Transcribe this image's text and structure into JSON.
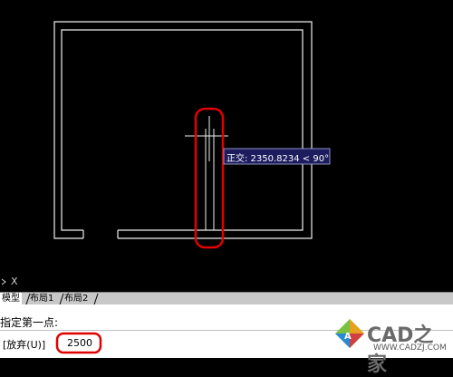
{
  "tooltip": {
    "text": "正交: 2350.8234 < 90°"
  },
  "ucs": {
    "x_label": "X"
  },
  "tabs": [
    {
      "label": "模型"
    },
    {
      "label": "布局1"
    },
    {
      "label": "布局2"
    }
  ],
  "command": {
    "line1": "指定第一点:",
    "prompt": "[放弃(U)]",
    "input_value": "2500"
  },
  "watermark": {
    "brand": "CAD之家",
    "url": "WWW.CADZJ.COM"
  },
  "colors": {
    "background": "#000000",
    "lines": "#ffffff",
    "highlight": "#e00000",
    "tooltip_bg": "#1c1c5e"
  }
}
